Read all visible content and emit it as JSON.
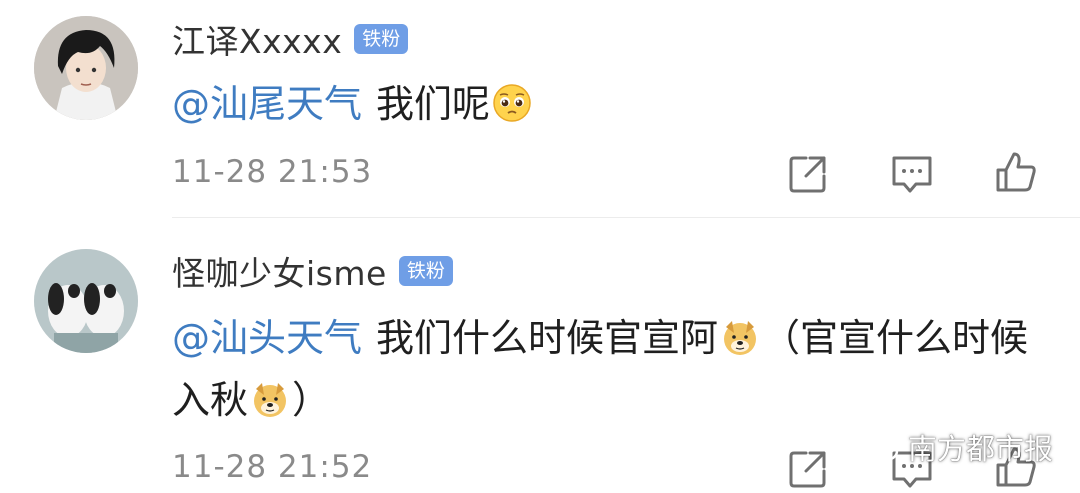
{
  "comments": [
    {
      "user": "江译Xxxxx",
      "badge": "铁粉",
      "mention": "@汕尾天气",
      "text": "我们呢",
      "emoji": "pleading-face-icon",
      "time": "11-28 21:53"
    },
    {
      "user": "怪咖少女isme",
      "badge": "铁粉",
      "mention": "@汕头天气",
      "text_part1": "我们什么时候官宣阿",
      "text_part2": "（官宣什么时候入秋",
      "text_part3": "）",
      "emoji": "doge-icon",
      "time": "11-28 21:52"
    }
  ],
  "actions": [
    "share-icon",
    "comment-icon",
    "like-icon"
  ],
  "watermark": "南方都市报",
  "colors": {
    "mention": "#3f7cc1",
    "badge": "#6f9ee6",
    "time": "#8a8a8a"
  }
}
